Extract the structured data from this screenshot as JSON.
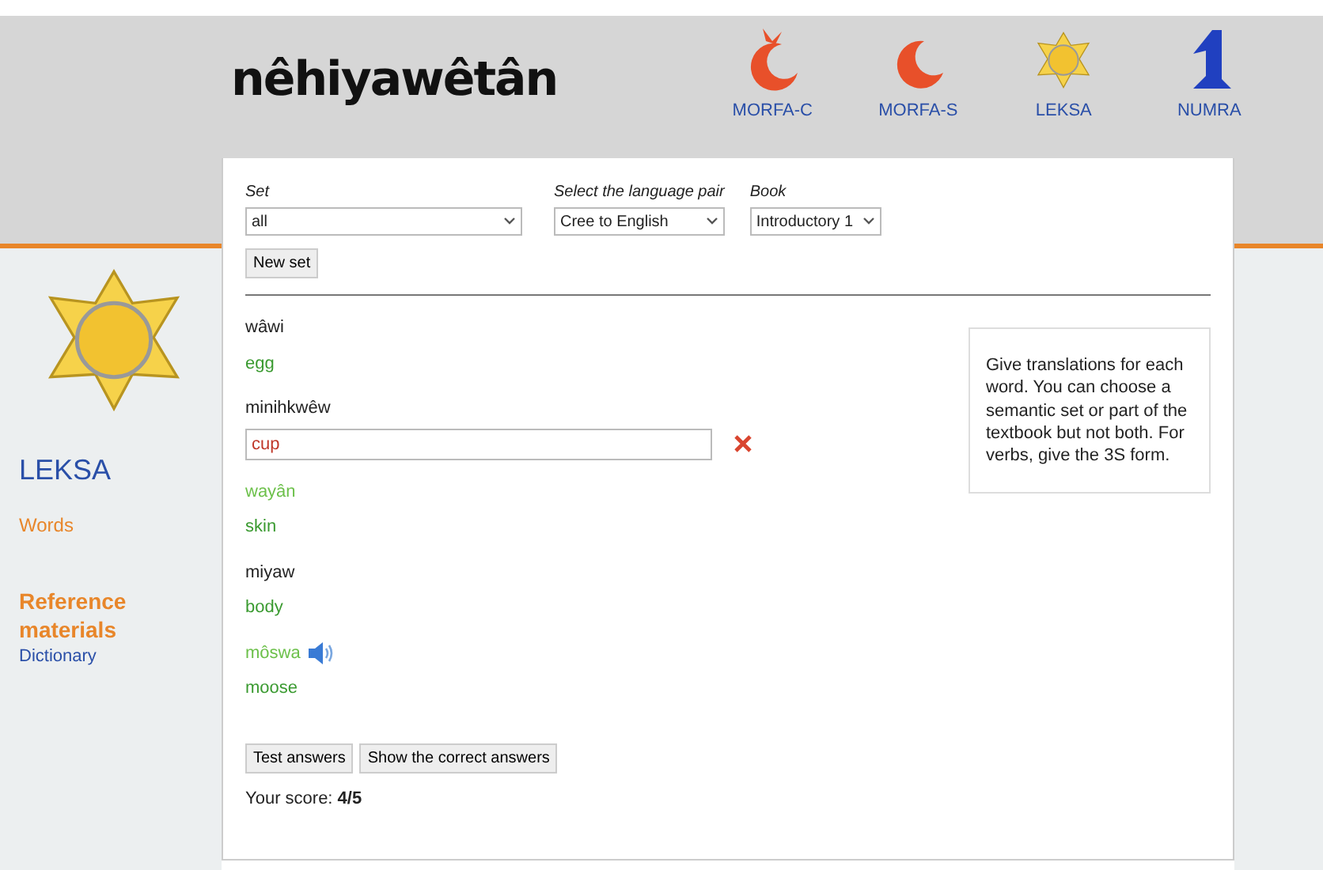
{
  "header": {
    "logo": "nêhiyawêtân",
    "nav": [
      {
        "label": "MORFA-C",
        "kind": "crescent-tail"
      },
      {
        "label": "MORFA-S",
        "kind": "crescent"
      },
      {
        "label": "LEKSA",
        "kind": "star"
      },
      {
        "label": "NUMRA",
        "kind": "numeral"
      }
    ]
  },
  "sidebar": {
    "title": "LEKSA",
    "links": [
      {
        "label": "Words",
        "kind": "section-link"
      },
      {
        "label": "Reference materials",
        "kind": "heading"
      },
      {
        "label": "Dictionary",
        "kind": "link"
      }
    ]
  },
  "form": {
    "fields": [
      {
        "label": "Set",
        "value": "all"
      },
      {
        "label": "Select the language pair",
        "value": "Cree to English"
      },
      {
        "label": "Book",
        "value": "Introductory 1"
      }
    ],
    "new_set": "New set"
  },
  "words": [
    {
      "word": "wâwi",
      "highlighted": false,
      "audio": false,
      "kind": "correct",
      "answer": "egg"
    },
    {
      "word": "minihkwêw",
      "highlighted": false,
      "audio": false,
      "kind": "wrong",
      "answer": "cup"
    },
    {
      "word": "wayân",
      "highlighted": true,
      "audio": false,
      "kind": "correct",
      "answer": "skin"
    },
    {
      "word": "miyaw",
      "highlighted": false,
      "audio": false,
      "kind": "correct",
      "answer": "body"
    },
    {
      "word": "môswa",
      "highlighted": true,
      "audio": true,
      "kind": "correct",
      "answer": "moose"
    }
  ],
  "info": "Give translations for each word. You can choose a semantic set or part of the textbook but not both. For verbs, give the 3S form.",
  "buttons": [
    "Test answers",
    "Show the correct answers"
  ],
  "score": "Your score: **4/5**"
}
